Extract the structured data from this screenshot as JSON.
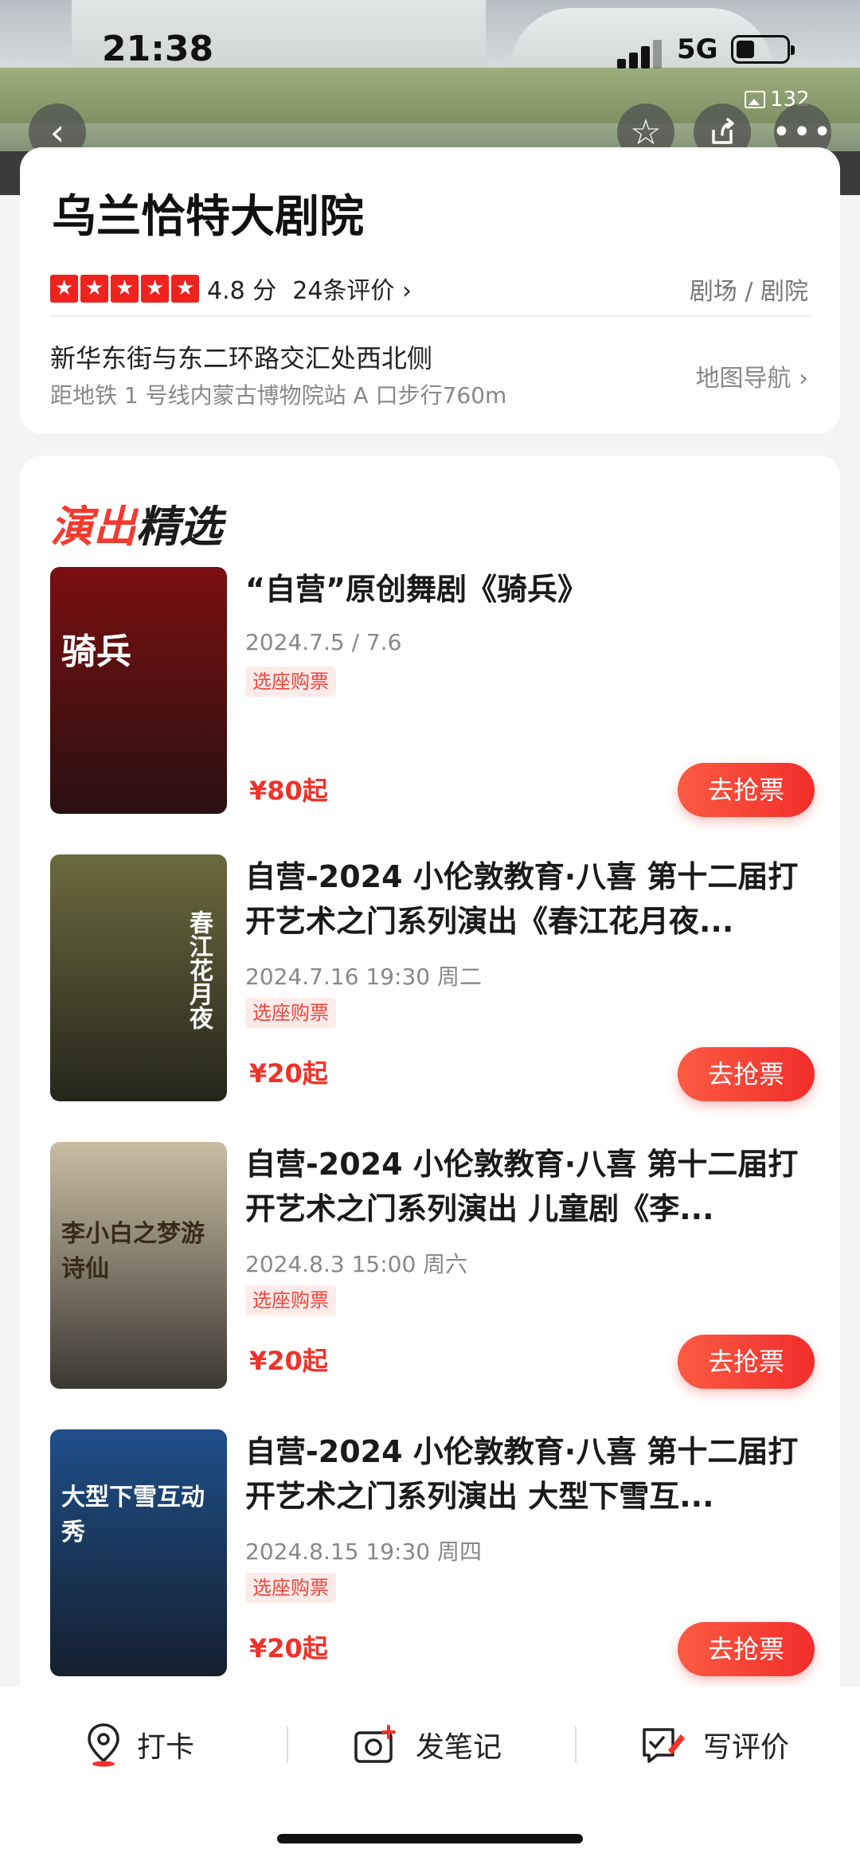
{
  "status_bar": {
    "time": "21:38",
    "network": "5G"
  },
  "header": {
    "photo_count": "132"
  },
  "venue": {
    "name": "乌兰恰特大剧院",
    "stars": [
      "★",
      "★",
      "★",
      "★",
      "★"
    ],
    "score": "4.8 分",
    "reviews": "24条评价 ›",
    "category": "剧场 / 剧院",
    "address": "新华东街与东二环路交汇处西北侧",
    "distance": "距地铁 1 号线内蒙古博物院站 A 口步行760m",
    "map_nav": "地图导航 ›"
  },
  "section": {
    "title_red": "演出",
    "title_black": "精选"
  },
  "shows": [
    {
      "title": "“自营”原创舞剧《骑兵》",
      "date": "2024.7.5 / 7.6",
      "tag": "选座购票",
      "price": "¥80起",
      "button": "去抢票",
      "poster_text": "骑兵",
      "poster_color": "#7a0f10"
    },
    {
      "title": "自营-2024 小伦敦教育·八喜 第十二届打开艺术之门系列演出《春江花月夜...",
      "date": "2024.7.16 19:30 周二",
      "tag": "选座购票",
      "price": "¥20起",
      "button": "去抢票",
      "poster_text": "春江花月夜",
      "poster_color": "#6b6a3e"
    },
    {
      "title": "自营-2024 小伦敦教育·八喜 第十二届打开艺术之门系列演出 儿童剧《李...",
      "date": "2024.8.3 15:00 周六",
      "tag": "选座购票",
      "price": "¥20起",
      "button": "去抢票",
      "poster_text": "李小白之梦游诗仙",
      "poster_color": "#c9bda3"
    },
    {
      "title": "自营-2024 小伦敦教育·八喜 第十二届打开艺术之门系列演出  大型下雪互...",
      "date": "2024.8.15 19:30 周四",
      "tag": "选座购票",
      "price": "¥20起",
      "button": "去抢票",
      "poster_text": "大型下雪互动秀",
      "poster_color": "#1f4f8a"
    }
  ],
  "bottom_bar": {
    "checkin": "打卡",
    "post_note": "发笔记",
    "write_review": "写评价"
  }
}
